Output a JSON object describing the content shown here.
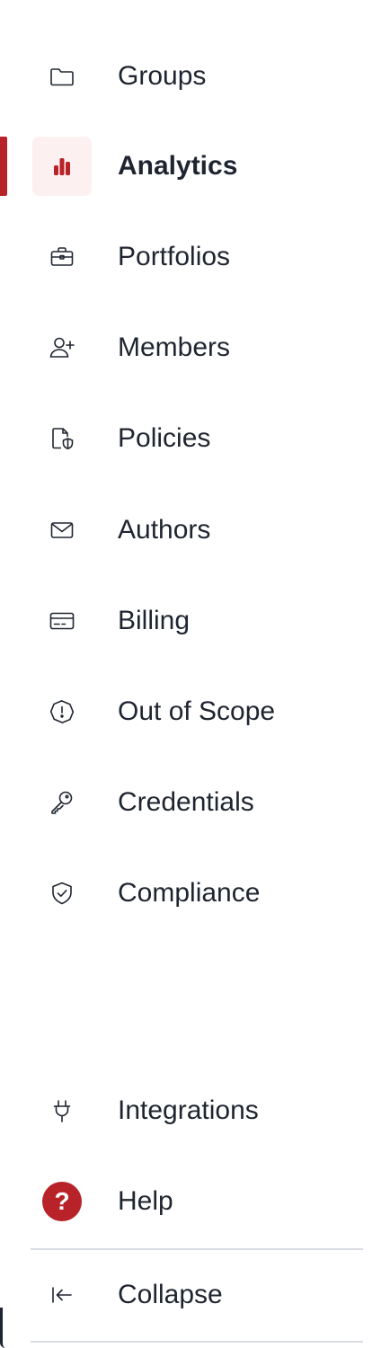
{
  "colors": {
    "accent": "#b8232a",
    "active_bg": "#fcf1f0",
    "text": "#1f2530",
    "divider": "#d9dce1"
  },
  "nav": {
    "items": [
      {
        "label": "Groups",
        "icon": "folder-icon",
        "active": false
      },
      {
        "label": "Analytics",
        "icon": "bar-chart-icon",
        "active": true
      },
      {
        "label": "Portfolios",
        "icon": "briefcase-icon",
        "active": false
      },
      {
        "label": "Members",
        "icon": "user-plus-icon",
        "active": false
      },
      {
        "label": "Policies",
        "icon": "document-shield-icon",
        "active": false
      },
      {
        "label": "Authors",
        "icon": "envelope-icon",
        "active": false
      },
      {
        "label": "Billing",
        "icon": "credit-card-icon",
        "active": false
      },
      {
        "label": "Out of Scope",
        "icon": "alert-octagon-icon",
        "active": false
      },
      {
        "label": "Credentials",
        "icon": "key-icon",
        "active": false
      },
      {
        "label": "Compliance",
        "icon": "shield-check-icon",
        "active": false
      }
    ]
  },
  "footer": {
    "integrations_label": "Integrations",
    "help_label": "Help",
    "help_badge": "?",
    "collapse_label": "Collapse"
  }
}
